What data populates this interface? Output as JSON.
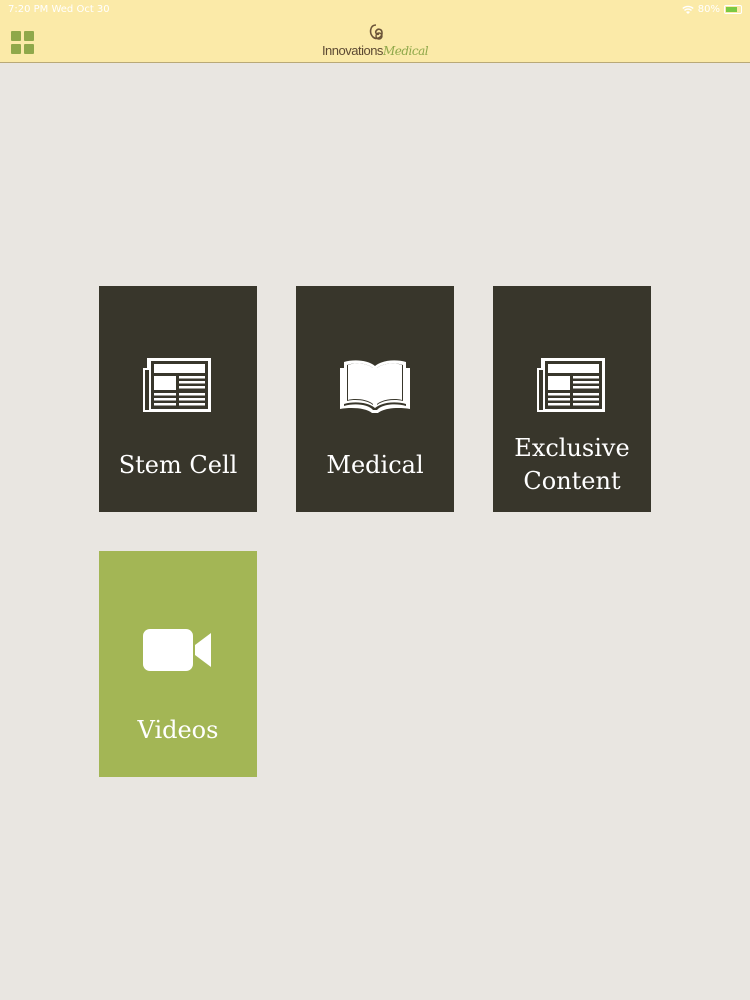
{
  "status_bar": {
    "time": "7:20 PM   Wed Oct 30",
    "battery": "80%",
    "battery_level": 0.8
  },
  "header": {
    "brand_part1": "Innovations",
    "brand_part2": "Medical",
    "menu_icon": "grid-icon",
    "background_color": "#fbeaa8"
  },
  "tiles": [
    {
      "label": "Stem Cell",
      "icon": "newspaper-icon",
      "color": "#38362b"
    },
    {
      "label": "Medical",
      "icon": "book-icon",
      "color": "#38362b"
    },
    {
      "label": "Exclusive Content",
      "label_line1": "Exclusive",
      "label_line2": "Content",
      "icon": "newspaper-icon",
      "color": "#38362b"
    },
    {
      "label": "Videos",
      "icon": "video-camera-icon",
      "color": "#a3b655"
    }
  ],
  "page_background": "#e9e6e1"
}
